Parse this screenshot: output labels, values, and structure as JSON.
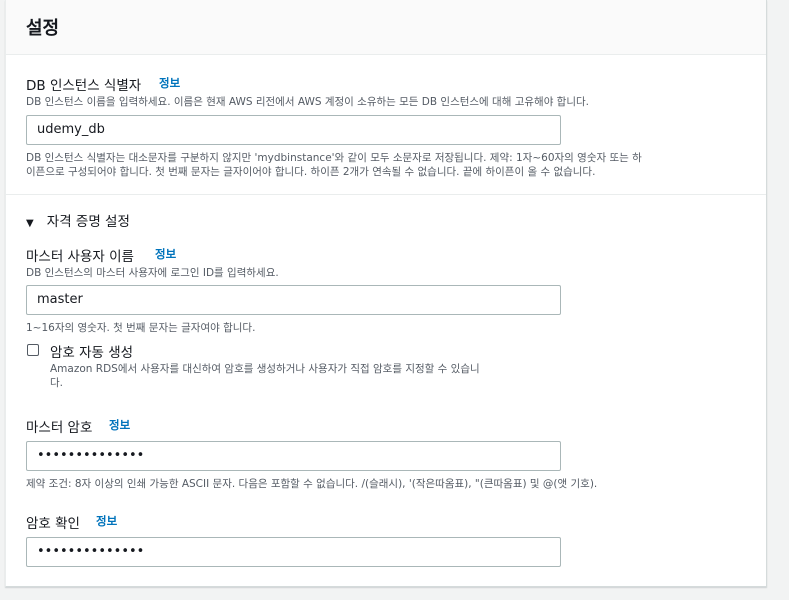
{
  "header": {
    "title": "설정"
  },
  "db_identifier": {
    "label": "DB 인스턴스 식별자",
    "info": "정보",
    "description": "DB 인스턴스 이름을 입력하세요. 이름은 현재 AWS 리전에서 AWS 계정이 소유하는 모든 DB 인스턴스에 대해 고유해야 합니다.",
    "value": "udemy_db",
    "constraint_line1": "DB 인스턴스 식별자는 대소문자를 구분하지 않지만 'mydbinstance'와 같이 모두 소문자로 저장됩니다. 제약: 1자~60자의 영숫자 또는 하",
    "constraint_line2": "이픈으로 구성되어야 합니다. 첫 번째 문자는 글자이어야 합니다. 하이픈 2개가 연속될 수 없습니다. 끝에 하이픈이 올 수 없습니다."
  },
  "credentials": {
    "section_title": "자격 증명 설정",
    "caret_icon": "caret-down-icon",
    "master_username": {
      "label": "마스터 사용자 이름",
      "info": "정보",
      "description": "DB 인스턴스의 마스터 사용자에 로그인 ID를 입력하세요.",
      "value": "master",
      "constraint": "1~16자의 영숫자. 첫 번째 문자는 글자여야 합니다."
    },
    "auto_generate": {
      "label": "암호 자동 생성",
      "checked": false,
      "description_line1": "Amazon RDS에서 사용자를 대신하여 암호를 생성하거나 사용자가 직접 암호를 지정할 수 있습니",
      "description_line2": "다."
    },
    "master_password": {
      "label": "마스터 암호",
      "info": "정보",
      "value": "••••••••••••••",
      "constraint": "제약 조건: 8자 이상의 인쇄 가능한 ASCII 문자. 다음은 포함할 수 없습니다. /(슬래시), '(작은따옴표), \"(큰따옴표) 및 @(앳 기호)."
    },
    "confirm_password": {
      "label": "암호 확인",
      "info": "정보",
      "value": "••••••••••••••"
    }
  },
  "colors": {
    "link": "#0073bb",
    "text": "#16191f",
    "muted": "#545b64",
    "border": "#aab7b8"
  }
}
